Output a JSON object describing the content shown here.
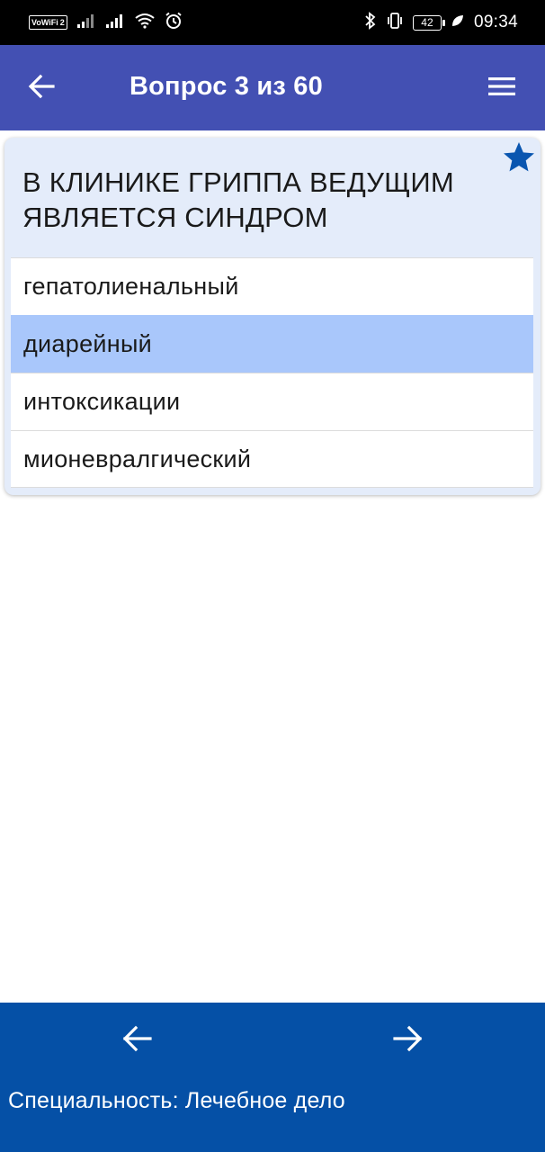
{
  "status_bar": {
    "vowifi": "VoWiFi",
    "vowifi_sub": "2",
    "battery": "42",
    "time": "09:34",
    "icons": [
      "signal-icon",
      "signal-icon",
      "wifi-icon",
      "alarm-icon",
      "bluetooth-icon",
      "vibrate-icon",
      "battery-icon",
      "leaf-icon"
    ]
  },
  "app_bar": {
    "title": "Вопрос 3 из 60",
    "back_icon": "arrow-left-icon",
    "menu_icon": "hamburger-menu-icon",
    "color": "#4350b3"
  },
  "question": {
    "text": "В КЛИНИКЕ ГРИППА ВЕДУЩИМ ЯВЛЯЕТСЯ СИНДРОМ",
    "favorite_icon": "star-icon",
    "answers": [
      {
        "label": "гепатолиенальный",
        "selected": false
      },
      {
        "label": "диарейный",
        "selected": true
      },
      {
        "label": "интоксикации",
        "selected": false
      },
      {
        "label": "мионевралгический",
        "selected": false
      }
    ]
  },
  "bottom_bar": {
    "prev_icon": "arrow-left-icon",
    "next_icon": "arrow-right-icon",
    "specialty": "Специальность: Лечебное дело",
    "color": "#0550a6"
  },
  "colors": {
    "card_bg": "#e4ecfa",
    "selected_answer": "#a9c7fb",
    "star": "#0a56b0"
  }
}
